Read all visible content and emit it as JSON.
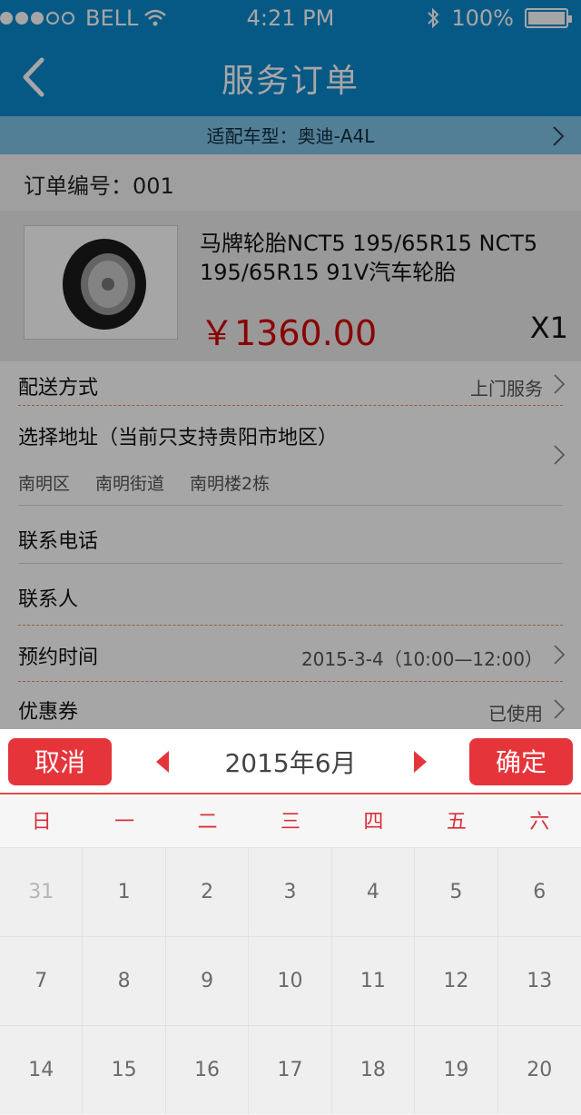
{
  "status_bar": {
    "carrier": "BELL",
    "time": "4:21 PM",
    "battery": "100%",
    "signal_filled": 3,
    "signal_total": 5
  },
  "nav": {
    "title": "服务订单"
  },
  "car_type": {
    "text": "适配车型：奥迪-A4L"
  },
  "order": {
    "number": "订单编号：001"
  },
  "product": {
    "name": "马牌轮胎NCT5 195/65R15  NCT5 195/65R15 91V汽车轮胎",
    "price": "￥1360.00",
    "qty": "X1"
  },
  "form": {
    "delivery_label": "配送方式",
    "delivery_value": "上门服务",
    "address_label": "选择地址（当前只支持贵阳市地区）",
    "address_parts": [
      "南明区",
      "南明街道",
      "南明楼2栋"
    ],
    "phone_label": "联系电话",
    "contact_label": "联系人",
    "appointment_label": "预约时间",
    "appointment_value": "2015-3-4（10:00—12:00）",
    "coupon_label": "优惠券",
    "coupon_value": "已使用"
  },
  "picker": {
    "cancel_label": "取消",
    "ok_label": "确定",
    "month": "2015年6月",
    "weekdays": [
      "日",
      "一",
      "二",
      "三",
      "四",
      "五",
      "六"
    ],
    "days": [
      {
        "d": "31",
        "dim": true
      },
      {
        "d": "1"
      },
      {
        "d": "2"
      },
      {
        "d": "3"
      },
      {
        "d": "4"
      },
      {
        "d": "5"
      },
      {
        "d": "6"
      },
      {
        "d": "7"
      },
      {
        "d": "8"
      },
      {
        "d": "9"
      },
      {
        "d": "10"
      },
      {
        "d": "11"
      },
      {
        "d": "12"
      },
      {
        "d": "13"
      },
      {
        "d": "14"
      },
      {
        "d": "15"
      },
      {
        "d": "16"
      },
      {
        "d": "17"
      },
      {
        "d": "18"
      },
      {
        "d": "19"
      },
      {
        "d": "20"
      }
    ]
  },
  "colors": {
    "nav_bg": "#0c89cc",
    "accent_red": "#e5353b",
    "price_red": "#d50000"
  }
}
